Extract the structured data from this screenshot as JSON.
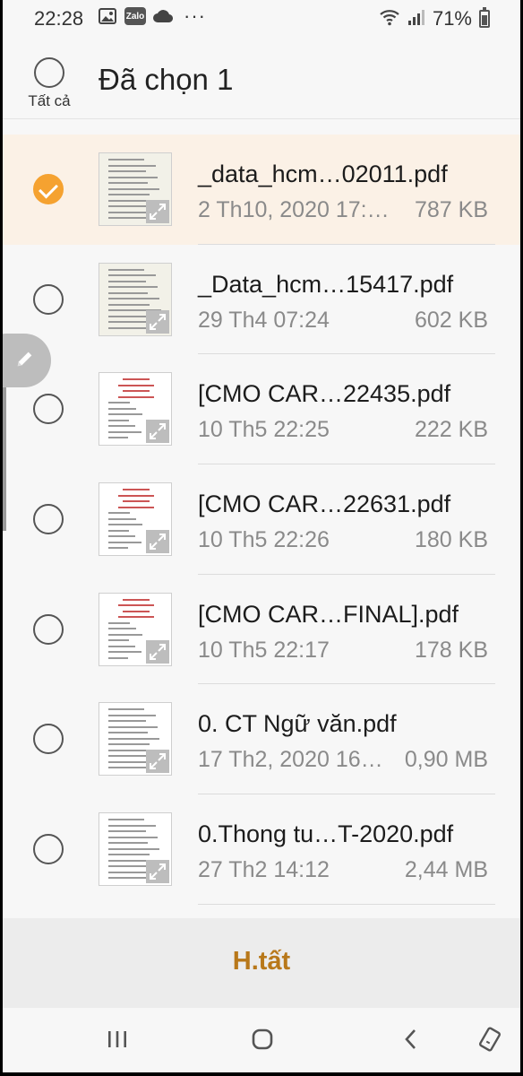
{
  "status_bar": {
    "time": "22:28",
    "left_icons": [
      "image-icon",
      "zalo-icon",
      "cloud-icon",
      "more-dots-icon"
    ],
    "zalo_label": "Zalo",
    "more": "···",
    "battery_percent": "71%",
    "battery_level": 0.71
  },
  "header": {
    "select_all_label": "Tất cả",
    "title": "Đã chọn 1"
  },
  "files": [
    {
      "name": "_data_hcm…02011.pdf",
      "date": "2 Th10, 2020 17:…",
      "size": "787 KB",
      "selected": true
    },
    {
      "name": "_Data_hcm…15417.pdf",
      "date": "29 Th4 07:24",
      "size": "602 KB",
      "selected": false
    },
    {
      "name": "[CMO CAR…22435.pdf",
      "date": "10 Th5 22:25",
      "size": "222 KB",
      "selected": false
    },
    {
      "name": "[CMO CAR…22631.pdf",
      "date": "10 Th5 22:26",
      "size": "180 KB",
      "selected": false
    },
    {
      "name": "[CMO CAR…FINAL].pdf",
      "date": "10 Th5 22:17",
      "size": "178 KB",
      "selected": false
    },
    {
      "name": "0. CT Ngữ văn.pdf",
      "date": "17 Th2, 2020 16…",
      "size": "0,90 MB",
      "selected": false
    },
    {
      "name": "0.Thong tu…T-2020.pdf",
      "date": "27 Th2 14:12",
      "size": "2,44 MB",
      "selected": false
    }
  ],
  "bottom_action": {
    "label": "H.tất",
    "color": "#b8781a"
  },
  "colors": {
    "accent": "#f5a230",
    "selected_row_bg": "#fbf1e6"
  },
  "nav": [
    "recent-apps-icon",
    "home-icon",
    "back-icon",
    "rotate-icon"
  ]
}
